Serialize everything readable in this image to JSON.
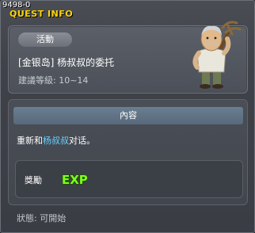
{
  "window": {
    "id_label": "9498-0",
    "title": "QUEST INFO"
  },
  "quest": {
    "category": "活動",
    "title": "[金银岛] 杨叔叔的委托",
    "level_requirement": "建議等級: 10~14"
  },
  "content": {
    "header": "內容",
    "text_before": "重新和",
    "text_highlight": "杨叔叔",
    "text_after": "对话。"
  },
  "reward": {
    "label": "獎勵",
    "exp_icon_text": "EXP"
  },
  "status": {
    "text": "狀態: 可開始"
  },
  "colors": {
    "title": "#ffd400",
    "highlight": "#6ad0ff",
    "exp": "#7dff1a"
  }
}
